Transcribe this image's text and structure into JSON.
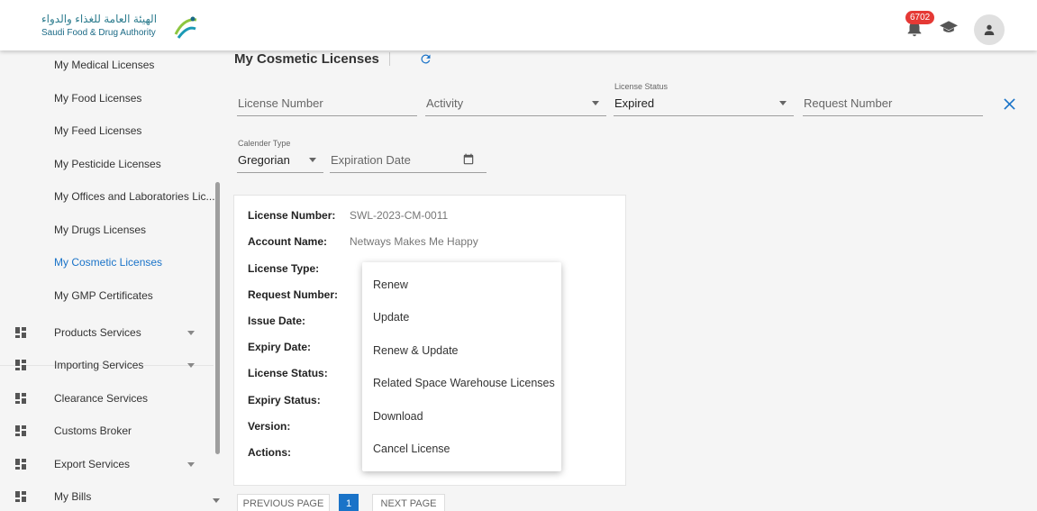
{
  "header": {
    "logo_ar": "الهيئة العامة للغذاء والدواء",
    "logo_en": "Saudi Food & Drug Authority",
    "notification_count": "6702"
  },
  "sidebar": {
    "sub_items": [
      {
        "label": "My Medical Licenses",
        "active": false
      },
      {
        "label": "My Food Licenses",
        "active": false
      },
      {
        "label": "My Feed Licenses",
        "active": false
      },
      {
        "label": "My Pesticide Licenses",
        "active": false
      },
      {
        "label": "My Offices and Laboratories Lic...",
        "active": false
      },
      {
        "label": "My Drugs Licenses",
        "active": false
      },
      {
        "label": "My Cosmetic Licenses",
        "active": true
      },
      {
        "label": "My GMP Certificates",
        "active": false
      }
    ],
    "main_items": [
      {
        "label": "Products Services",
        "icon": "dashboard-icon",
        "expandable": true
      },
      {
        "label": "Importing Services",
        "icon": "dashboard-icon",
        "expandable": true
      },
      {
        "label": "Clearance Services",
        "icon": "dashboard-icon",
        "expandable": false
      },
      {
        "label": "Customs Broker",
        "icon": "dashboard-icon",
        "expandable": false
      },
      {
        "label": "Export Services",
        "icon": "dashboard-icon",
        "expandable": true
      },
      {
        "label": "My Bills",
        "icon": "dashboard-icon",
        "expandable": false
      }
    ]
  },
  "main": {
    "title": "My Cosmetic Licenses",
    "filters": {
      "license_number_placeholder": "License Number",
      "activity_placeholder": "Activity",
      "license_status_label": "License Status",
      "license_status_value": "Expired",
      "request_number_placeholder": "Request Number",
      "calendar_type_label": "Calender Type",
      "calendar_type_value": "Gregorian",
      "expiration_date_placeholder": "Expiration Date"
    },
    "card": {
      "rows": [
        {
          "label": "License Number:",
          "value": "SWL-2023-CM-0011"
        },
        {
          "label": "Account Name:",
          "value": "Netways Makes Me Happy"
        },
        {
          "label": "License Type:",
          "value": ""
        },
        {
          "label": "Request Number:",
          "value": ""
        },
        {
          "label": "Issue Date:",
          "value": ""
        },
        {
          "label": "Expiry Date:",
          "value": ""
        },
        {
          "label": "License Status:",
          "value": ""
        },
        {
          "label": "Expiry Status:",
          "value": ""
        },
        {
          "label": "Version:",
          "value": ""
        },
        {
          "label": "Actions:",
          "value": ""
        }
      ]
    },
    "actions_menu": [
      "Renew",
      "Update",
      "Renew & Update",
      "Related Space Warehouse Licenses",
      "Download",
      "Cancel License"
    ],
    "pagination": {
      "previous": "PREVIOUS PAGE",
      "current": "1",
      "next": "NEXT PAGE"
    }
  },
  "colors": {
    "accent": "#1a73c8",
    "badge": "#e53935"
  }
}
